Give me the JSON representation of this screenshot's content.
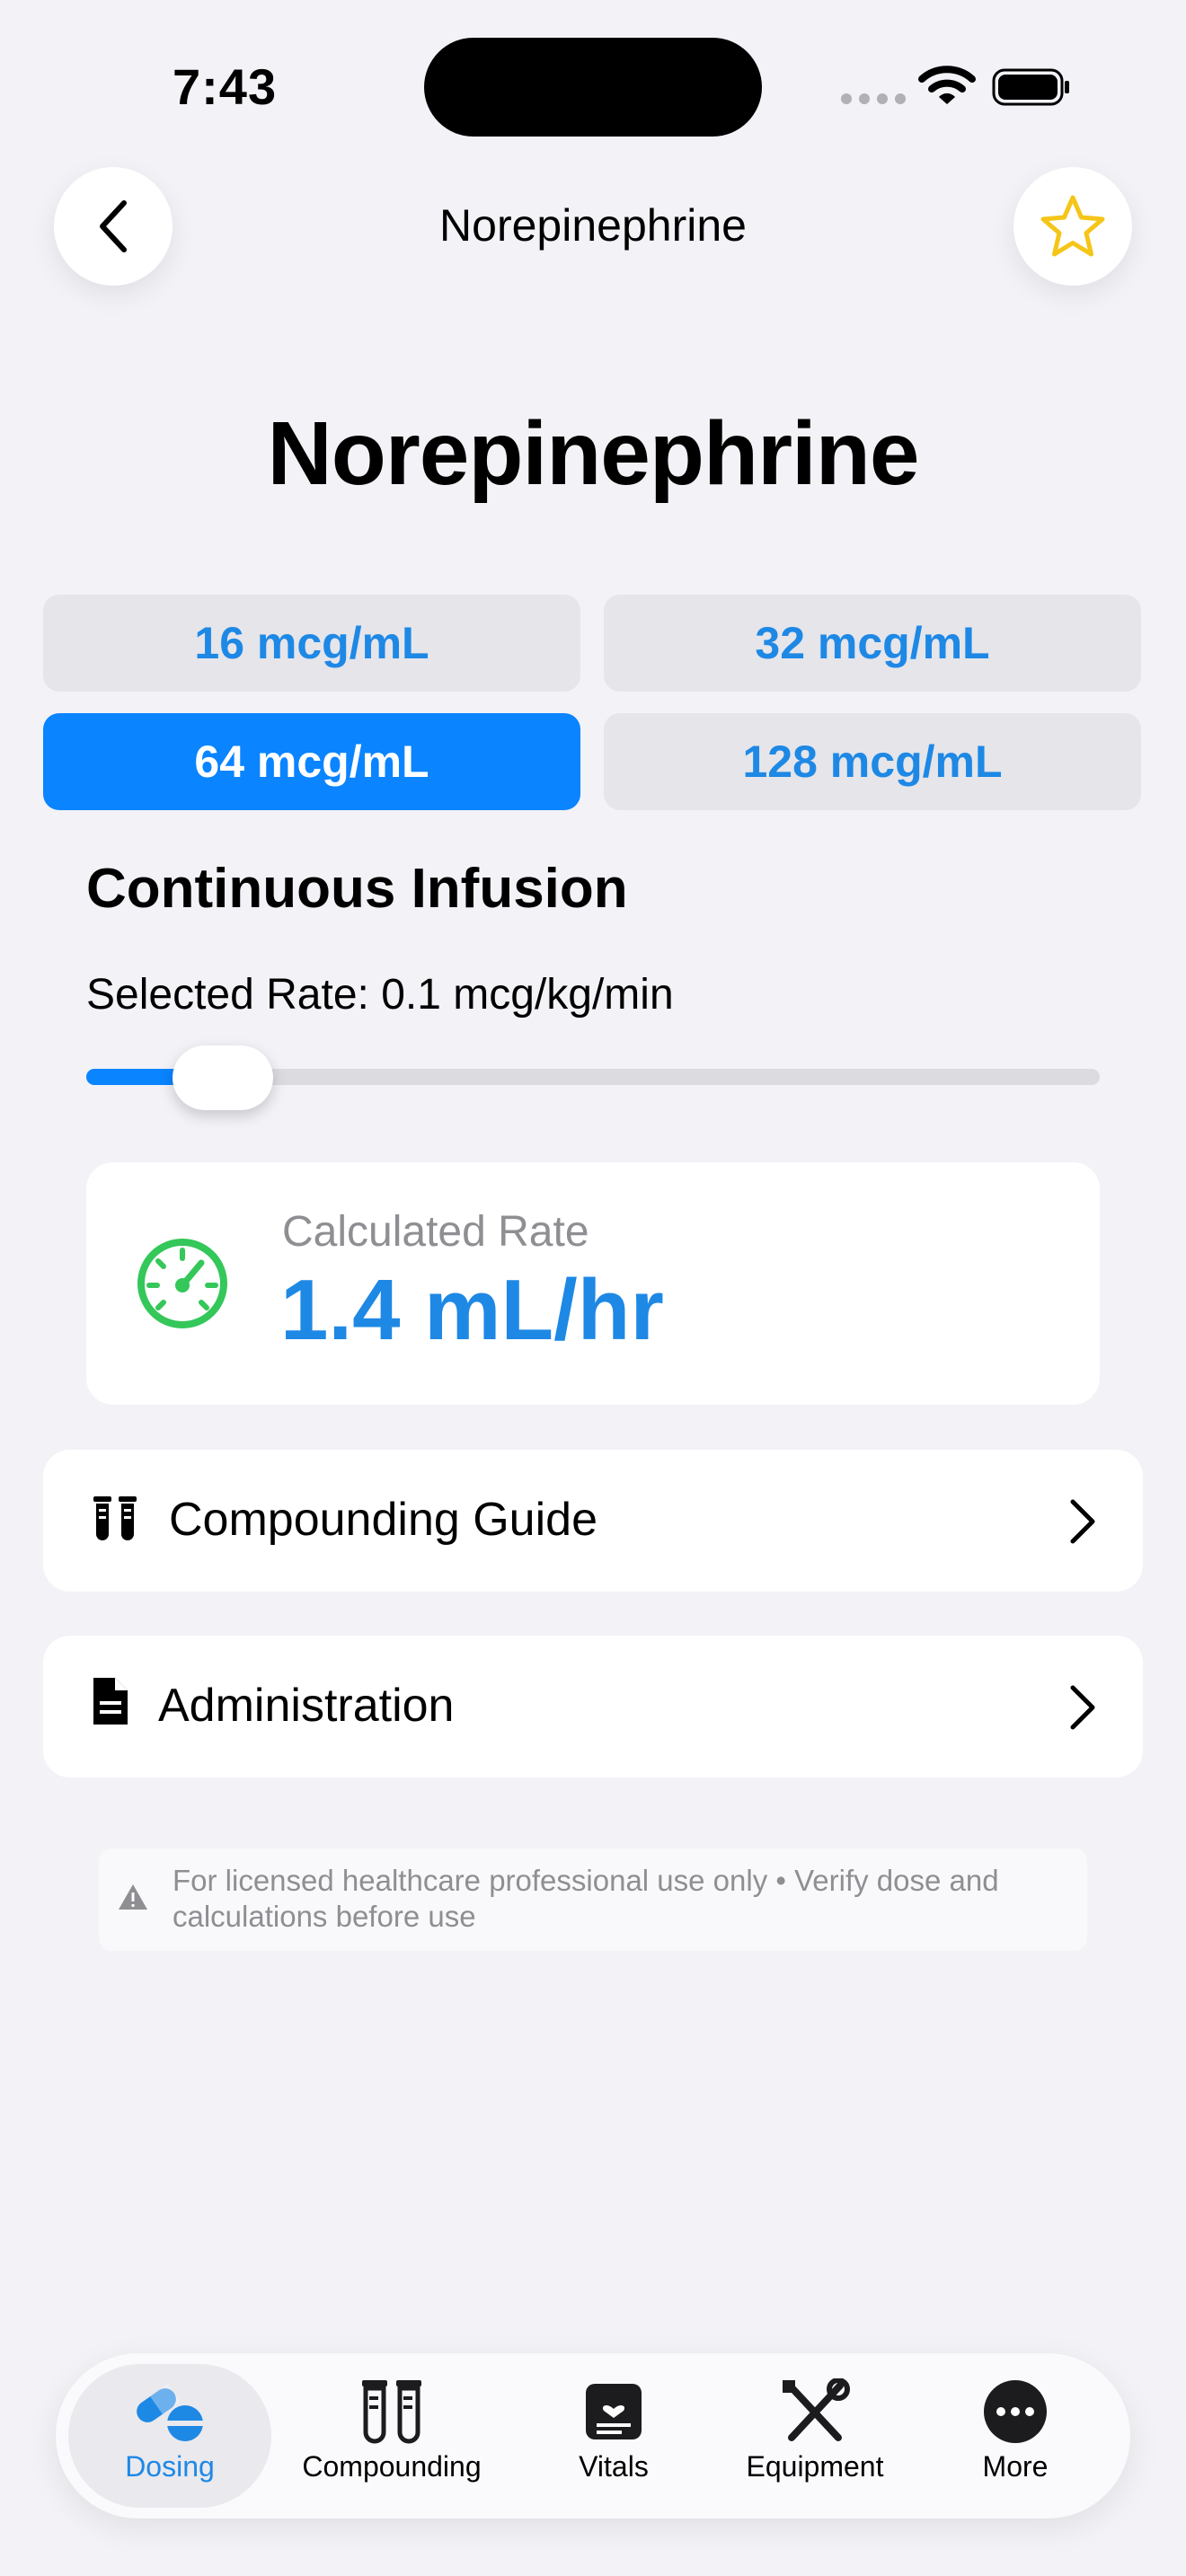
{
  "status_bar": {
    "time": "7:43"
  },
  "nav": {
    "title": "Norepinephrine",
    "back_icon": "chevron-left-icon",
    "favorite_icon": "star-icon"
  },
  "drug": {
    "name": "Norepinephrine"
  },
  "concentrations": {
    "options": [
      "16 mcg/mL",
      "32 mcg/mL",
      "64 mcg/mL",
      "128 mcg/mL"
    ],
    "selected": "64 mcg/mL"
  },
  "infusion": {
    "heading": "Continuous Infusion",
    "selected_rate_label": "Selected Rate: 0.1 mcg/kg/min",
    "slider_fraction": 0.1
  },
  "calculated": {
    "label": "Calculated Rate",
    "value": "1.4 mL/hr",
    "icon": "gauge-icon"
  },
  "rows": [
    {
      "label": "Compounding Guide",
      "icon": "test-tubes-icon"
    },
    {
      "label": "Administration",
      "icon": "document-icon"
    }
  ],
  "disclaimer": {
    "text": "For licensed healthcare professional use only • Verify dose and calculations before use",
    "icon": "warning-icon"
  },
  "tabs": [
    {
      "label": "Dosing",
      "icon": "pills-icon",
      "active": true
    },
    {
      "label": "Compounding",
      "icon": "test-tubes-icon"
    },
    {
      "label": "Vitals",
      "icon": "vitals-icon"
    },
    {
      "label": "Equipment",
      "icon": "tools-icon"
    },
    {
      "label": "More",
      "icon": "more-icon"
    }
  ],
  "colors": {
    "accent": "#0A84FF",
    "accent_text": "#1E88E5",
    "gauge": "#34C759",
    "star": "#F5C518",
    "background": "#F2F2F7"
  }
}
